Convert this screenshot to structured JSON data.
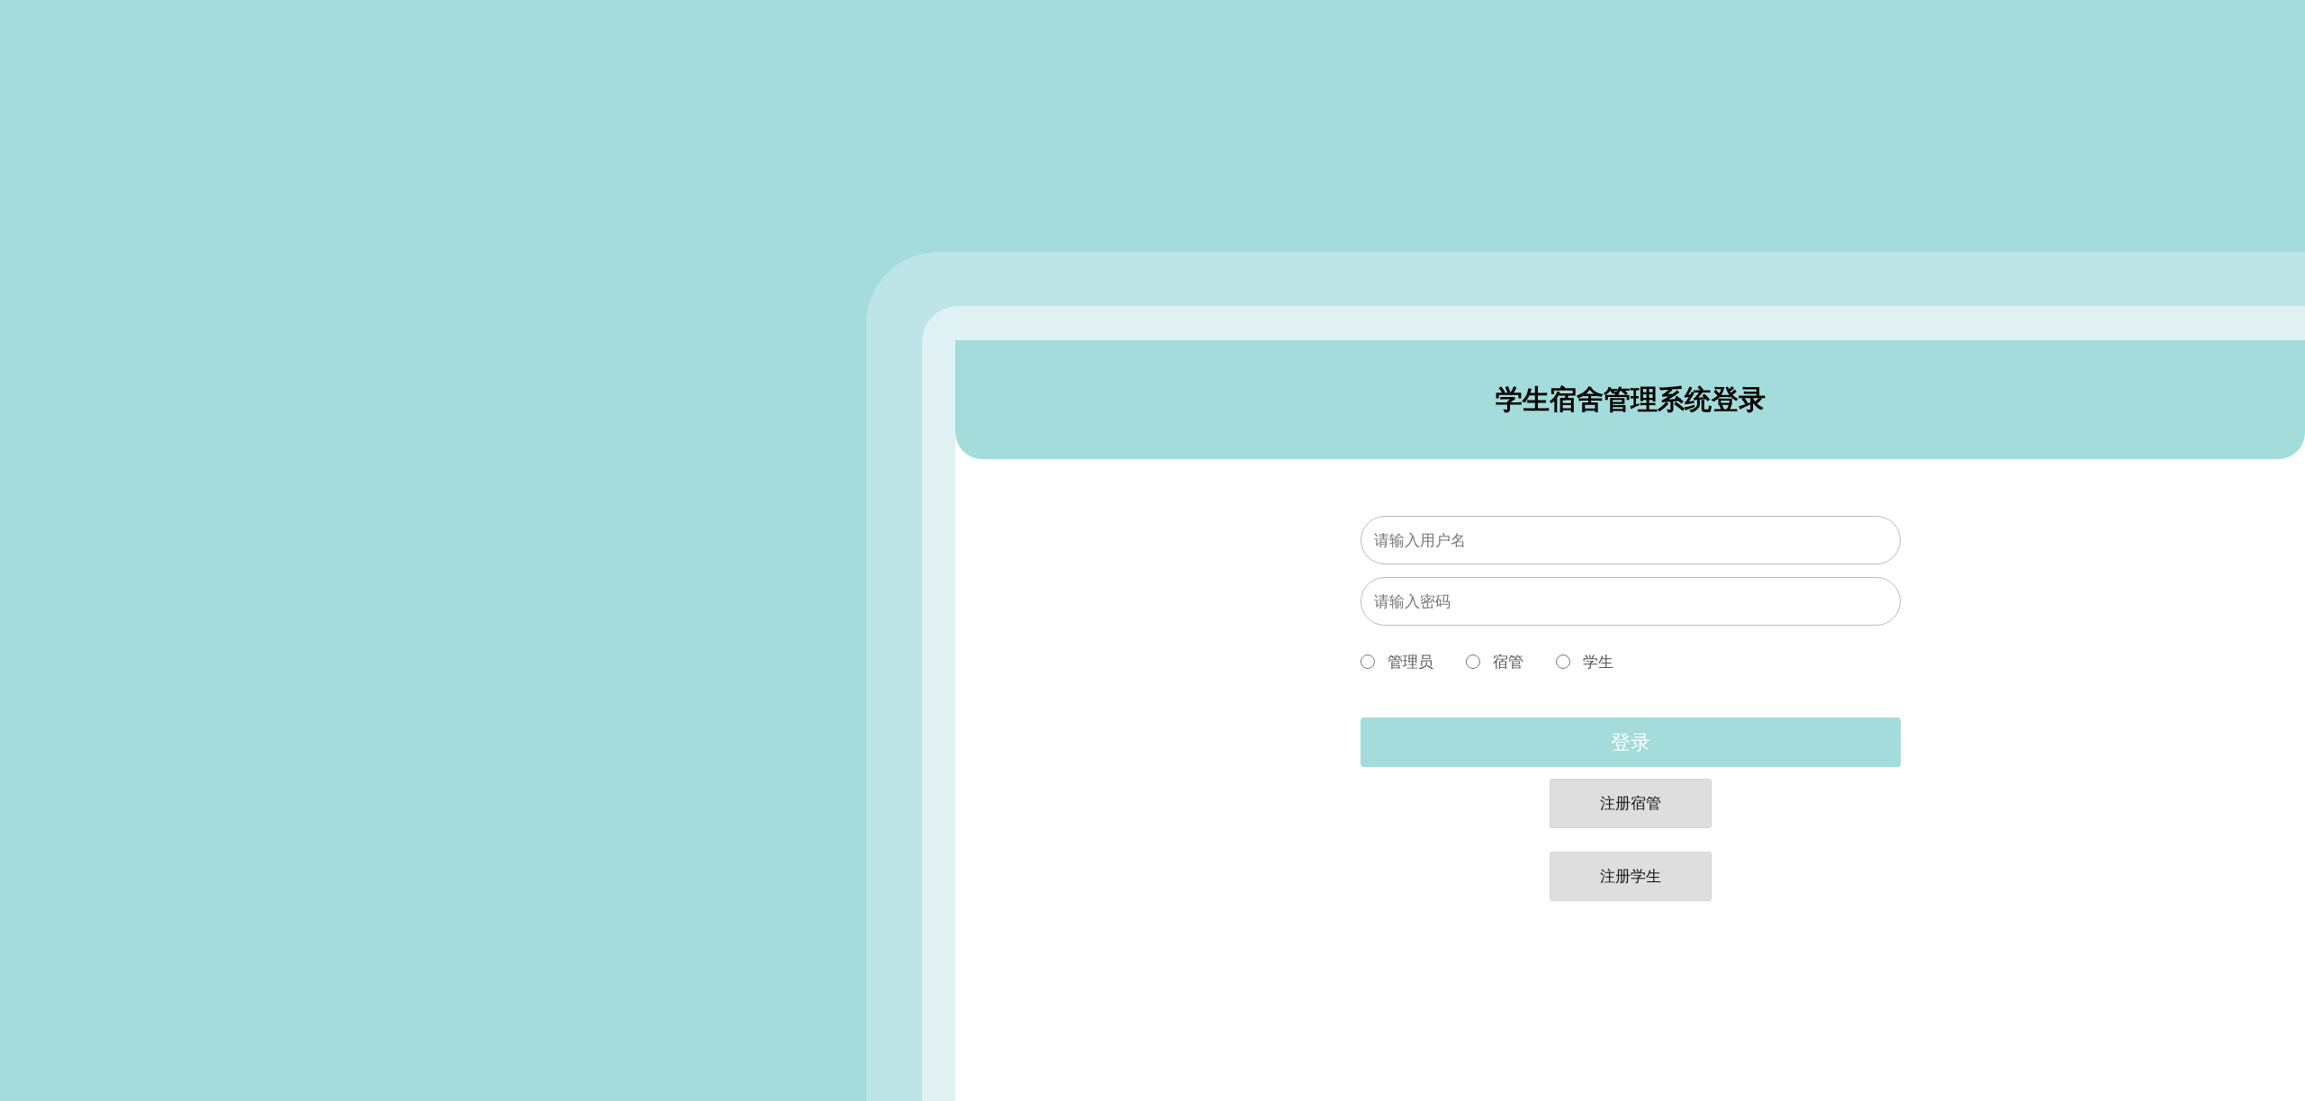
{
  "login_card": {
    "title": "学生宿舍管理系统登录",
    "username_field": {
      "placeholder": "请输入用户名"
    },
    "password_field": {
      "placeholder": "请输入密码"
    },
    "roles": [
      {
        "label": "管理员",
        "selected": false
      },
      {
        "label": "宿管",
        "selected": false
      },
      {
        "label": "学生",
        "selected": false
      }
    ],
    "login_button": "登录",
    "register_buttons": [
      "注册宿管",
      "注册学生"
    ]
  }
}
